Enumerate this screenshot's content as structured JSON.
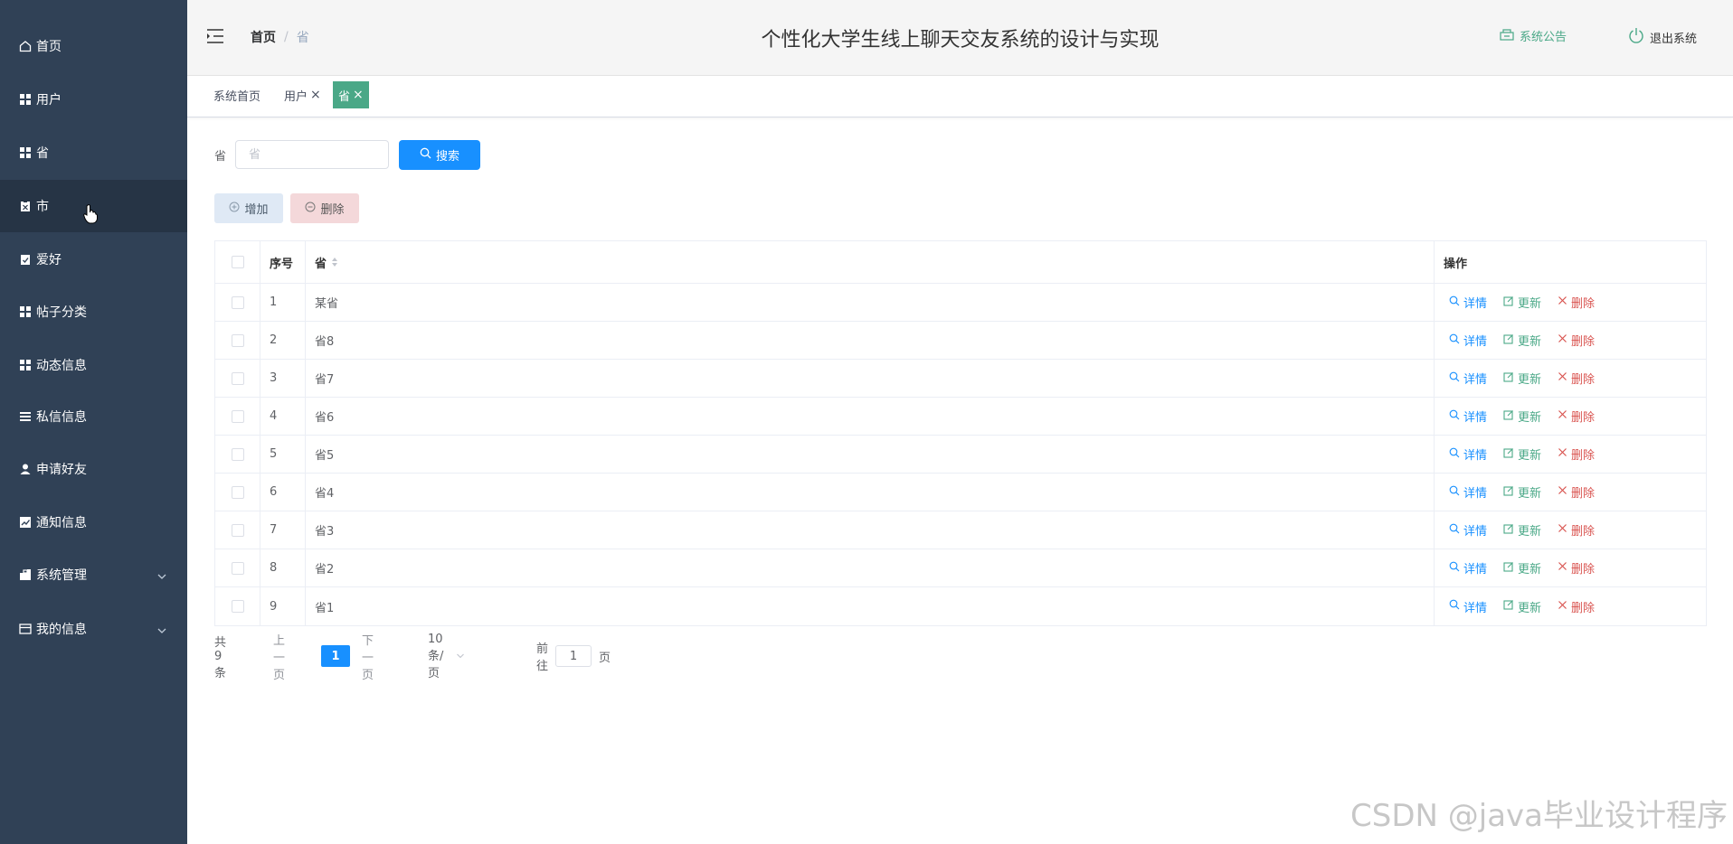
{
  "sidebar": {
    "items": [
      {
        "label": "首页",
        "icon": "home-icon"
      },
      {
        "label": "用户",
        "icon": "grid-icon"
      },
      {
        "label": "省",
        "icon": "grid-icon"
      },
      {
        "label": "市",
        "icon": "clipboard-icon"
      },
      {
        "label": "爱好",
        "icon": "clipboard-check-icon"
      },
      {
        "label": "帖子分类",
        "icon": "grid-icon"
      },
      {
        "label": "动态信息",
        "icon": "grid-icon"
      },
      {
        "label": "私信信息",
        "icon": "list-icon"
      },
      {
        "label": "申请好友",
        "icon": "user-icon"
      },
      {
        "label": "通知信息",
        "icon": "chart-icon"
      },
      {
        "label": "系统管理",
        "icon": "briefcase-icon"
      },
      {
        "label": "我的信息",
        "icon": "card-icon"
      }
    ]
  },
  "header": {
    "breadcrumb_home": "首页",
    "breadcrumb_sep": "/",
    "breadcrumb_current": "省",
    "title": "个性化大学生线上聊天交友系统的设计与实现",
    "notice": "系统公告",
    "logout": "退出系统"
  },
  "tags": {
    "items": [
      {
        "label": "系统首页",
        "closable": false
      },
      {
        "label": "用户",
        "closable": true
      },
      {
        "label": "省",
        "closable": true
      }
    ],
    "close_glyph": "×"
  },
  "search": {
    "label": "省",
    "placeholder": "省",
    "button": "搜索"
  },
  "actions": {
    "add": "增加",
    "delete": "删除"
  },
  "table": {
    "headers": {
      "index": "序号",
      "name": "省",
      "ops": "操作"
    },
    "ops": {
      "detail": "详情",
      "update": "更新",
      "delete": "删除"
    },
    "rows": [
      {
        "index": "1",
        "name": "某省"
      },
      {
        "index": "2",
        "name": "省8"
      },
      {
        "index": "3",
        "name": "省7"
      },
      {
        "index": "4",
        "name": "省6"
      },
      {
        "index": "5",
        "name": "省5"
      },
      {
        "index": "6",
        "name": "省4"
      },
      {
        "index": "7",
        "name": "省3"
      },
      {
        "index": "8",
        "name": "省2"
      },
      {
        "index": "9",
        "name": "省1"
      }
    ]
  },
  "pagination": {
    "total": "共 9 条",
    "prev": "上一页",
    "page": "1",
    "next": "下一页",
    "size": "10条/页",
    "goto": "前往",
    "goto_value": "1",
    "goto_suffix": "页"
  },
  "watermark": "CSDN @java毕业设计程序",
  "colors": {
    "sidebar": "#304156",
    "sidebar_active": "#263445",
    "accent": "#4aa887",
    "primary": "#1890ff",
    "danger": "#d9534f"
  }
}
